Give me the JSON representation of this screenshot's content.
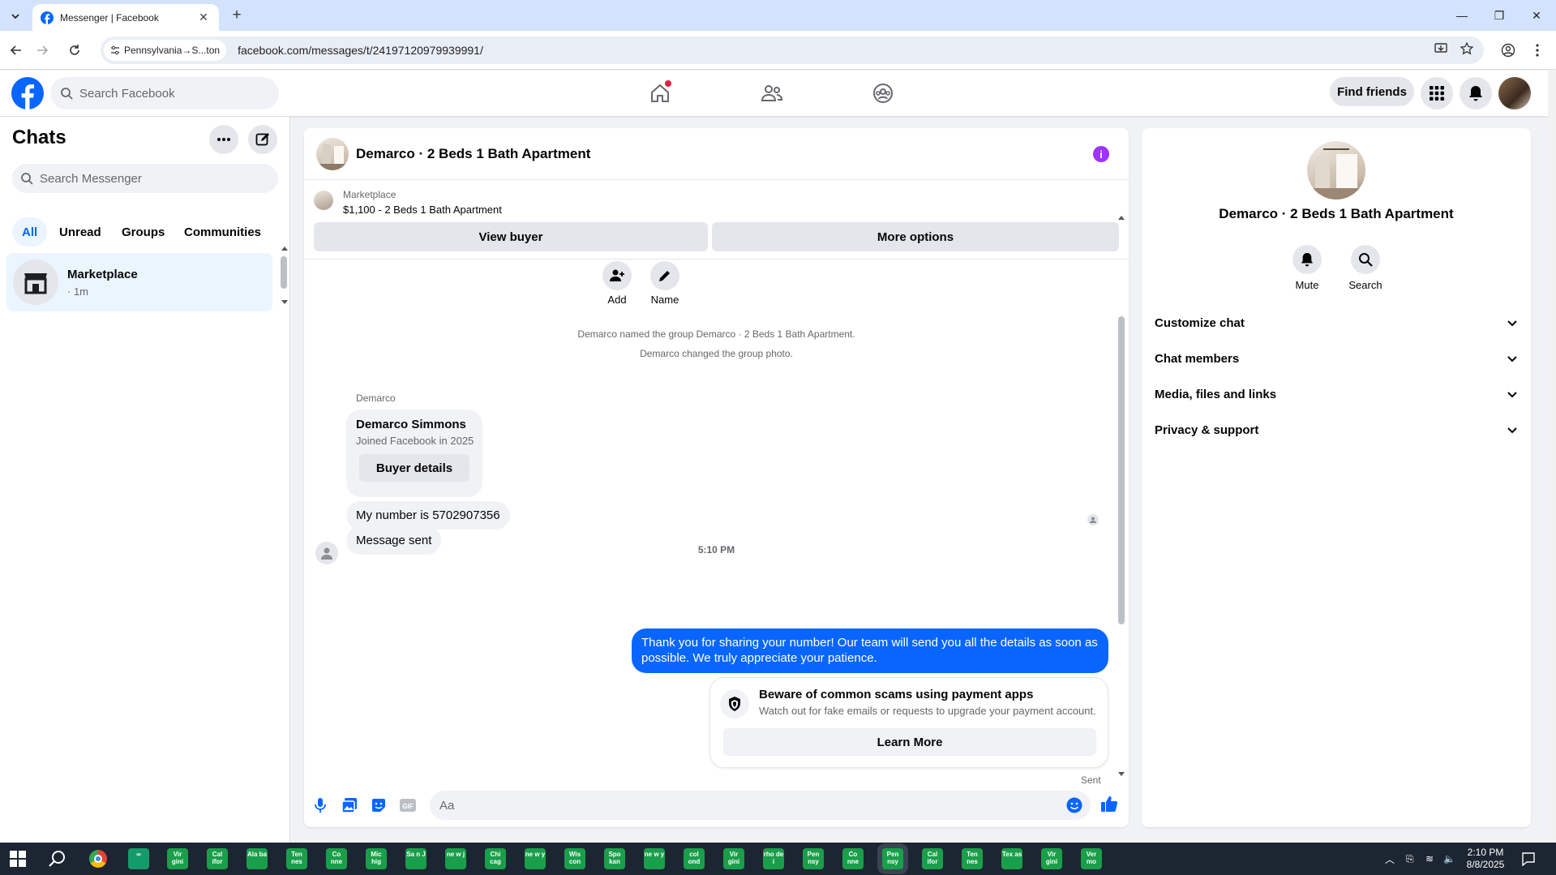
{
  "browser": {
    "tab_title": "Messenger | Facebook",
    "site_chip": "Pennsylvania→S...ton",
    "url": "facebook.com/messages/t/24197120979939991/"
  },
  "fb": {
    "search_placeholder": "Search Facebook",
    "find_friends": "Find friends"
  },
  "chats": {
    "title": "Chats",
    "search_placeholder": "Search Messenger",
    "filters": [
      "All",
      "Unread",
      "Groups",
      "Communities"
    ],
    "active_filter": "All",
    "items": [
      {
        "name": "Marketplace",
        "time": "· 1m"
      }
    ]
  },
  "conversation": {
    "title": "Demarco · 2 Beds 1 Bath Apartment",
    "marketplace": {
      "source": "Marketplace",
      "listing": "$1,100 - 2 Beds 1 Bath Apartment",
      "view_buyer": "View buyer",
      "more_options": "More options"
    },
    "actions": {
      "add": "Add",
      "name": "Name"
    },
    "system_messages": [
      "Demarco named the group Demarco · 2 Beds 1 Bath Apartment.",
      "Demarco changed the group photo."
    ],
    "sender": "Demarco",
    "buyer_card": {
      "name": "Demarco Simmons",
      "joined": "Joined Facebook in 2025",
      "button": "Buyer details"
    },
    "incoming": [
      "My number is 5702907356",
      "Message sent"
    ],
    "timestamp": "5:10 PM",
    "outgoing": "Thank you for sharing your number! Our team will send you all the details as soon as possible. We truly appreciate your patience.",
    "scam_notice": {
      "title": "Beware of common scams using payment apps",
      "subtitle": "Watch out for fake emails or requests to upgrade your payment account.",
      "button": "Learn More"
    },
    "status": "Sent",
    "composer_placeholder": "Aa"
  },
  "details": {
    "name": "Demarco · 2 Beds 1 Bath Apartment",
    "actions": {
      "mute": "Mute",
      "search": "Search"
    },
    "sections": [
      "Customize chat",
      "Chat members",
      "Media, files and links",
      "Privacy & support"
    ]
  },
  "taskbar": {
    "apps": [
      "Vir gini",
      "Cal ifor",
      "Ala ba",
      "Ten nes",
      "Co nne",
      "Mic hig",
      "Sa n J",
      "ne w j",
      "Chi cag",
      "ne w y",
      "Wis con",
      "Spo kan",
      "ne w y",
      "col ond",
      "Vir gini",
      "rho de i",
      "Pen nsy",
      "Co nne",
      "Pen nsy",
      "Cal ifor",
      "Ten nes",
      "Tex as",
      "Vir gini",
      "Ver mo"
    ],
    "time": "2:10 PM",
    "date": "8/8/2025"
  },
  "colors": {
    "accent": "#0866ff",
    "facebook_blue": "#0866ff",
    "info_purple": "#a033ff",
    "taskbar_app": "#1a9e4a"
  }
}
